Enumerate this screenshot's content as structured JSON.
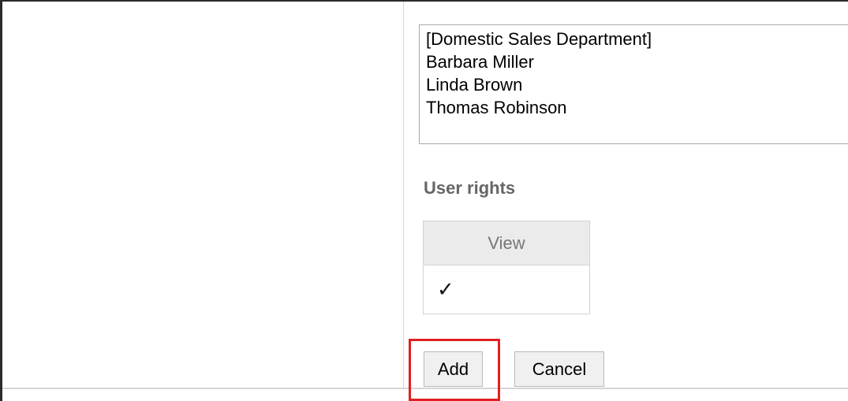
{
  "members": {
    "items": [
      "[Domestic Sales Department]",
      "Barbara Miller",
      "Linda Brown",
      "Thomas Robinson"
    ]
  },
  "rights": {
    "section_title": "User rights",
    "column_view": "View",
    "view_mark": "✓"
  },
  "actions": {
    "add_label": "Add",
    "cancel_label": "Cancel"
  }
}
